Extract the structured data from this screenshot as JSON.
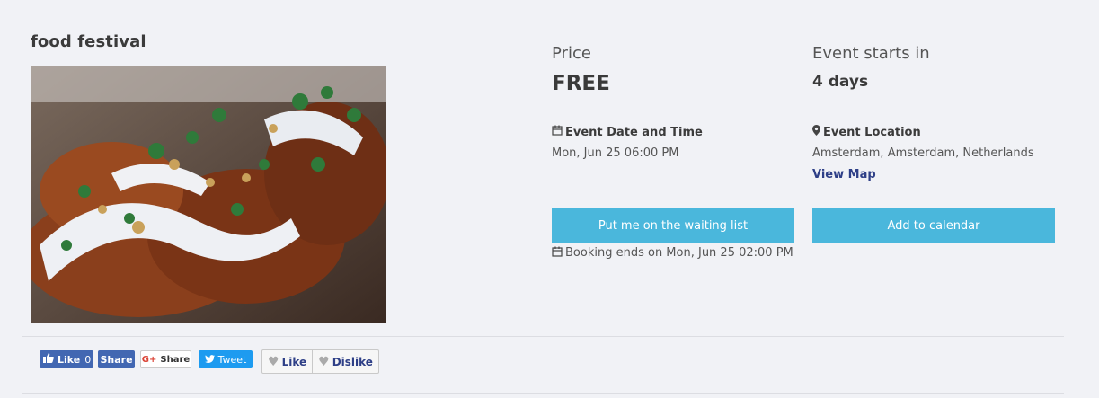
{
  "event": {
    "title": "food festival",
    "image_alt": "fried food with creamy sauce and herbs"
  },
  "price": {
    "label": "Price",
    "value": "FREE"
  },
  "starts": {
    "label": "Event starts in",
    "value": "4 days"
  },
  "date_time": {
    "icon": "calendar-icon",
    "label": "Event Date and Time",
    "value": "Mon, Jun 25 06:00 PM"
  },
  "location": {
    "icon": "map-marker-icon",
    "label": "Event Location",
    "value": "Amsterdam, Amsterdam, Netherlands",
    "map_link": "View Map"
  },
  "actions": {
    "waiting_list": "Put me on the waiting list",
    "add_calendar": "Add to calendar"
  },
  "booking": {
    "icon": "calendar-icon",
    "text": "Booking ends on Mon, Jun 25 02:00 PM"
  },
  "social": {
    "fb_like_label": "Like",
    "fb_like_count": "0",
    "fb_share_label": "Share",
    "google_share_label": "Share",
    "tweet_label": "Tweet",
    "like_label": "Like",
    "dislike_label": "Dislike"
  },
  "colors": {
    "accent_button": "#4ab7dc",
    "link": "#2e3f87",
    "facebook": "#4267b2",
    "twitter": "#1d9bf0",
    "background": "#f1f2f6"
  }
}
